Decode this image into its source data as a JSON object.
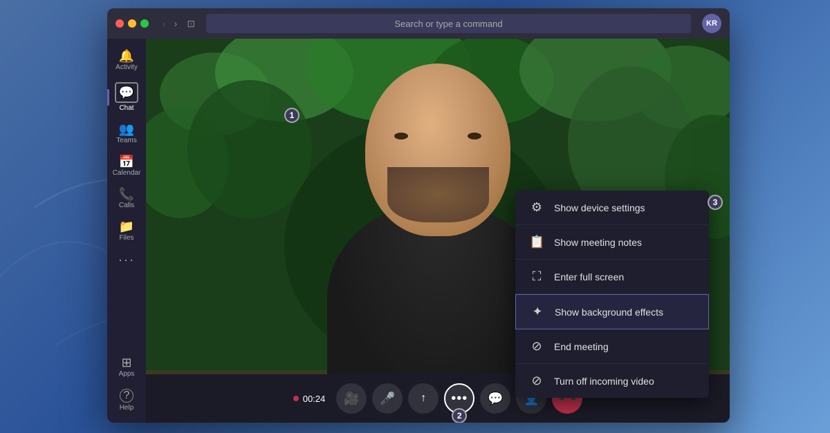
{
  "background": {
    "gradient_start": "#4a6fa5",
    "gradient_end": "#2a5298"
  },
  "titlebar": {
    "search_placeholder": "Search or type a command",
    "avatar_initials": "KR",
    "back_arrow": "‹",
    "forward_arrow": "›"
  },
  "sidebar": {
    "items": [
      {
        "id": "activity",
        "label": "Activity",
        "icon": "🔔",
        "active": false
      },
      {
        "id": "chat",
        "label": "Chat",
        "icon": "💬",
        "active": true
      },
      {
        "id": "teams",
        "label": "Teams",
        "icon": "👥",
        "active": false
      },
      {
        "id": "calendar",
        "label": "Calendar",
        "icon": "📅",
        "active": false
      },
      {
        "id": "calls",
        "label": "Calls",
        "icon": "📞",
        "active": false
      },
      {
        "id": "files",
        "label": "Files",
        "icon": "📁",
        "active": false
      }
    ],
    "more_label": "···",
    "bottom_items": [
      {
        "id": "apps",
        "label": "Apps",
        "icon": "⊞"
      },
      {
        "id": "help",
        "label": "Help",
        "icon": "?"
      }
    ]
  },
  "annotation_badges": {
    "badge_1": "1",
    "badge_2": "2",
    "badge_3": "3"
  },
  "context_menu": {
    "items": [
      {
        "id": "device-settings",
        "icon": "⚙",
        "label": "Show device settings"
      },
      {
        "id": "meeting-notes",
        "icon": "📋",
        "label": "Show meeting notes"
      },
      {
        "id": "fullscreen",
        "icon": "⛶",
        "label": "Enter full screen"
      },
      {
        "id": "background-effects",
        "icon": "✦",
        "label": "Show background effects",
        "highlighted": true
      },
      {
        "id": "end-meeting",
        "icon": "⊘",
        "label": "End meeting"
      },
      {
        "id": "turn-off-video",
        "icon": "⊘",
        "label": "Turn off incoming video"
      }
    ]
  },
  "controls": {
    "timer": "00:24",
    "buttons": [
      {
        "id": "camera",
        "icon": "📷",
        "label": "Camera"
      },
      {
        "id": "mic",
        "icon": "🎤",
        "label": "Microphone"
      },
      {
        "id": "share",
        "icon": "↑",
        "label": "Share screen"
      },
      {
        "id": "more",
        "icon": "···",
        "label": "More options"
      },
      {
        "id": "chat-ctrl",
        "icon": "💬",
        "label": "Chat"
      },
      {
        "id": "participants",
        "icon": "👤",
        "label": "Participants"
      },
      {
        "id": "end-call",
        "icon": "📵",
        "label": "End call"
      }
    ]
  }
}
